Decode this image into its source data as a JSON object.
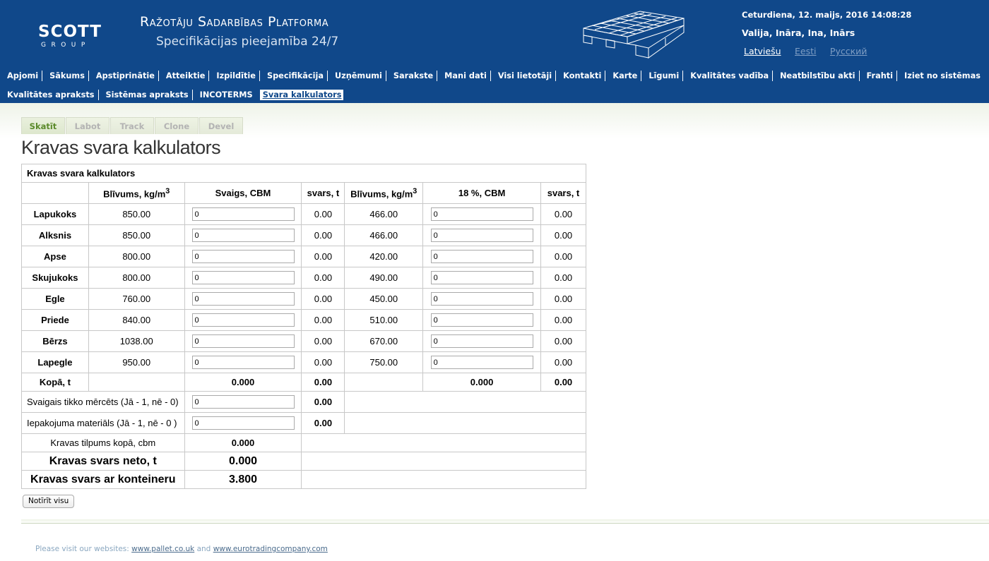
{
  "header": {
    "logo_main": "SCOTT",
    "logo_sub": "GROUP",
    "title": "Ražotāju Sadarbības Platforma",
    "subtitle": "Specifikācijas pieejamība 24/7",
    "datetime": "Ceturdiena, 12. maijs, 2016 14:08:28",
    "users": "Valija, Ināra, Ina, Inārs",
    "languages": [
      "Latviešu",
      "Eesti",
      "Русский"
    ],
    "active_language": "Latviešu"
  },
  "nav": {
    "row1": [
      "Apjomi",
      "Sākums",
      "Apstiprinātie",
      "Atteiktie",
      "Izpildītie",
      "Specifikācija",
      "Uzņēmumi",
      "Sarakste",
      "Mani dati",
      "Visi lietotāji",
      "Kontakti",
      "Karte",
      "Līgumi",
      "Kvalitātes vadība",
      "Neatbilstību akti",
      "Frahti",
      "Iziet no sistēmas"
    ],
    "row2": [
      "Kvalitātes apraksts",
      "Sistēmas apraksts",
      "INCOTERMS",
      "Svara kalkulators"
    ],
    "active": "Svara kalkulators"
  },
  "tabs": [
    "Skatīt",
    "Labot",
    "Track",
    "Clone",
    "Devel"
  ],
  "active_tab": "Skatīt",
  "page_title": "Kravas svara kalkulators",
  "table": {
    "caption": "Kravas svara kalkulators",
    "headers": {
      "density": "Blīvums, kg/m",
      "density_sup": "3",
      "fresh_cbm": "Svaigs, CBM",
      "weight": "svars, t",
      "dry_cbm": "18 %, CBM"
    },
    "rows": [
      {
        "name": "Lapukoks",
        "density_fresh": "850.00",
        "fresh_cbm": "0",
        "weight_fresh": "0.00",
        "density_dry": "466.00",
        "dry_cbm": "0",
        "weight_dry": "0.00"
      },
      {
        "name": "Alksnis",
        "density_fresh": "850.00",
        "fresh_cbm": "0",
        "weight_fresh": "0.00",
        "density_dry": "466.00",
        "dry_cbm": "0",
        "weight_dry": "0.00"
      },
      {
        "name": "Apse",
        "density_fresh": "800.00",
        "fresh_cbm": "0",
        "weight_fresh": "0.00",
        "density_dry": "420.00",
        "dry_cbm": "0",
        "weight_dry": "0.00"
      },
      {
        "name": "Skujukoks",
        "density_fresh": "800.00",
        "fresh_cbm": "0",
        "weight_fresh": "0.00",
        "density_dry": "490.00",
        "dry_cbm": "0",
        "weight_dry": "0.00"
      },
      {
        "name": "Egle",
        "density_fresh": "760.00",
        "fresh_cbm": "0",
        "weight_fresh": "0.00",
        "density_dry": "450.00",
        "dry_cbm": "0",
        "weight_dry": "0.00"
      },
      {
        "name": "Priede",
        "density_fresh": "840.00",
        "fresh_cbm": "0",
        "weight_fresh": "0.00",
        "density_dry": "510.00",
        "dry_cbm": "0",
        "weight_dry": "0.00"
      },
      {
        "name": "Bērzs",
        "density_fresh": "1038.00",
        "fresh_cbm": "0",
        "weight_fresh": "0.00",
        "density_dry": "670.00",
        "dry_cbm": "0",
        "weight_dry": "0.00"
      },
      {
        "name": "Lapegle",
        "density_fresh": "950.00",
        "fresh_cbm": "0",
        "weight_fresh": "0.00",
        "density_dry": "750.00",
        "dry_cbm": "0",
        "weight_dry": "0.00"
      }
    ],
    "total": {
      "label": "Kopā, t",
      "fresh_cbm": "0.000",
      "weight_fresh": "0.00",
      "dry_cbm": "0.000",
      "weight_dry": "0.00"
    },
    "fresh_measured": {
      "label": "Svaigais tikko mērcēts (Jā - 1, nē - 0)",
      "value": "0",
      "weight": "0.00"
    },
    "packaging": {
      "label": "Iepakojuma materiāls (Jā - 1, nē - 0 )",
      "value": "0",
      "weight": "0.00"
    },
    "volume_total": {
      "label": "Kravas tilpums kopā, cbm",
      "value": "0.000"
    },
    "net_weight": {
      "label": "Kravas svars neto, t",
      "value": "0.000"
    },
    "container_weight": {
      "label": "Kravas svars ar konteineru",
      "value": "3.800"
    }
  },
  "reset_button": "Notīrīt visu",
  "footer": {
    "prefix": "Please visit our websites:",
    "link1": "www.pallet.co.uk",
    "and": "and",
    "link2": "www.eurotradingcompany.com"
  }
}
